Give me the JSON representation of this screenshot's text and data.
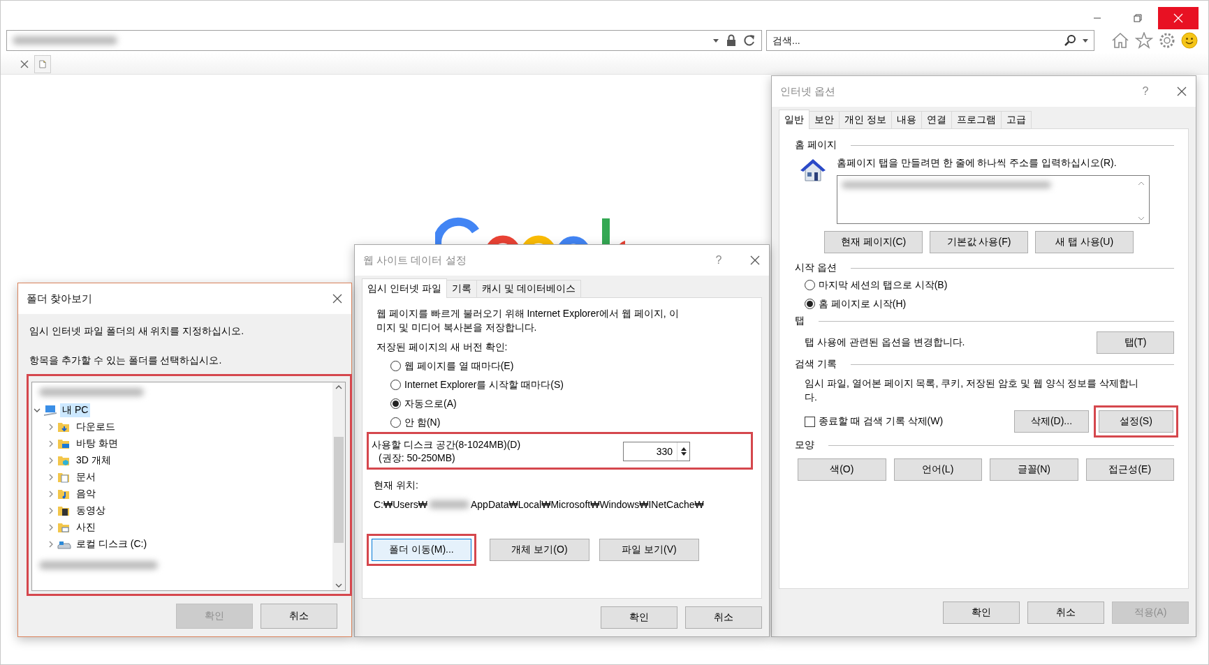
{
  "browser": {
    "search": {
      "placeholder": "검색..."
    }
  },
  "internet_options": {
    "title": "인터넷 옵션",
    "help": "?",
    "tabs": [
      {
        "label": "일반",
        "selected": true
      },
      {
        "label": "보안",
        "selected": false
      },
      {
        "label": "개인 정보",
        "selected": false
      },
      {
        "label": "내용",
        "selected": false
      },
      {
        "label": "연결",
        "selected": false
      },
      {
        "label": "프로그램",
        "selected": false
      },
      {
        "label": "고급",
        "selected": false
      }
    ],
    "home_page": {
      "heading": "홈 페이지",
      "instruction": "홈페이지 탭을 만들려면 한 줄에 하나씩 주소를 입력하십시오(R).",
      "buttons": [
        "현재 페이지(C)",
        "기본값 사용(F)",
        "새 탭 사용(U)"
      ]
    },
    "startup": {
      "heading": "시작 옵션",
      "options": [
        {
          "label": "마지막 세션의 탭으로 시작(B)",
          "selected": false
        },
        {
          "label": "홈 페이지로 시작(H)",
          "selected": true
        }
      ]
    },
    "tabs_section": {
      "heading": "탭",
      "description": "탭 사용에 관련된 옵션을 변경합니다.",
      "button": "탭(T)"
    },
    "history": {
      "heading": "검색 기록",
      "description": "임시 파일, 열어본 페이지 목록, 쿠키, 저장된 암호 및 웹 양식 정보를 삭제합니다.",
      "delete_on_exit": {
        "label": "종료할 때 검색 기록 삭제(W)",
        "checked": false
      },
      "buttons": [
        {
          "label": "삭제(D)...",
          "highlighted": false
        },
        {
          "label": "설정(S)",
          "highlighted": true
        }
      ]
    },
    "appearance": {
      "heading": "모양",
      "buttons": [
        "색(O)",
        "언어(L)",
        "글꼴(N)",
        "접근성(E)"
      ]
    },
    "footer": [
      {
        "label": "확인",
        "disabled": false
      },
      {
        "label": "취소",
        "disabled": false
      },
      {
        "label": "적용(A)",
        "disabled": true
      }
    ]
  },
  "website_data": {
    "title": "웹 사이트 데이터 설정",
    "help": "?",
    "tabs": [
      {
        "label": "임시 인터넷 파일",
        "selected": true
      },
      {
        "label": "기록",
        "selected": false
      },
      {
        "label": "캐시 및 데이터베이스",
        "selected": false
      }
    ],
    "description": "웹 페이지를 빠르게 불러오기 위해 Internet Explorer에서 웹 페이지, 이미지 및 미디어 복사본을 저장합니다.",
    "check_heading": "저장된 페이지의 새 버전 확인:",
    "check_options": [
      {
        "label": "웹 페이지를 열 때마다(E)",
        "selected": false
      },
      {
        "label": "Internet Explorer를 시작할 때마다(S)",
        "selected": false
      },
      {
        "label": "자동으로(A)",
        "selected": true
      },
      {
        "label": "안 함(N)",
        "selected": false
      }
    ],
    "disk_space": {
      "label": "사용할 디스크 공간(8-1024MB)(D)",
      "hint": "(권장: 50-250MB)",
      "value": "330",
      "highlighted": true
    },
    "location_label": "현재 위치:",
    "path_start": "C:₩Users₩",
    "path_end": "AppData₩Local₩Microsoft₩Windows₩INetCache₩",
    "buttons": [
      {
        "label": "폴더 이동(M)...",
        "highlighted": true,
        "focused": true
      },
      {
        "label": "개체 보기(O)",
        "highlighted": false,
        "focused": false
      },
      {
        "label": "파일 보기(V)",
        "highlighted": false,
        "focused": false
      }
    ],
    "footer": [
      {
        "label": "확인",
        "disabled": false
      },
      {
        "label": "취소",
        "disabled": false
      }
    ]
  },
  "folder_browser": {
    "title": "폴더 찾아보기",
    "instruction": "임시 인터넷 파일 폴더의 새 위치를 지정하십시오.",
    "prompt": "항목을 추가할 수 있는 폴더를 선택하십시오.",
    "tree_highlighted": true,
    "tree": [
      {
        "label": "내 PC",
        "kind": "computer",
        "expanded": true,
        "selected": true,
        "children": [
          {
            "label": "다운로드",
            "kind": "download",
            "expanded": false,
            "selected": false
          },
          {
            "label": "바탕 화면",
            "kind": "desktop",
            "expanded": false,
            "selected": false
          },
          {
            "label": "3D 개체",
            "kind": "objects",
            "expanded": false,
            "selected": false
          },
          {
            "label": "문서",
            "kind": "documents",
            "expanded": false,
            "selected": false
          },
          {
            "label": "음악",
            "kind": "music",
            "expanded": false,
            "selected": false
          },
          {
            "label": "동영상",
            "kind": "videos",
            "expanded": false,
            "selected": false
          },
          {
            "label": "사진",
            "kind": "pictures",
            "expanded": false,
            "selected": false
          },
          {
            "label": "로컬 디스크 (C:)",
            "kind": "drive",
            "expanded": false,
            "selected": false
          }
        ]
      }
    ],
    "footer": [
      {
        "label": "확인",
        "disabled": true
      },
      {
        "label": "취소",
        "disabled": false
      }
    ]
  }
}
